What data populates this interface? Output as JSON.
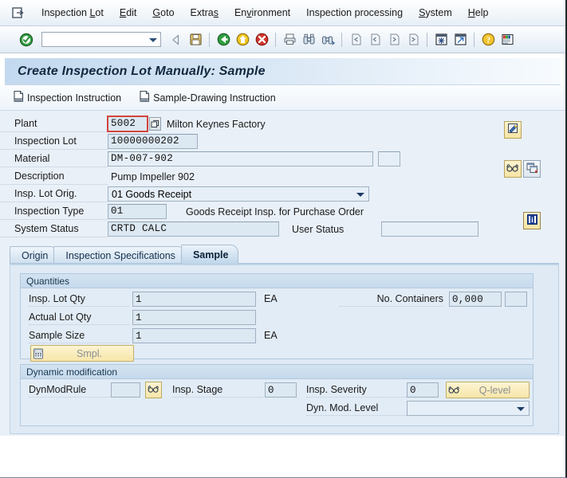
{
  "menu": {
    "system_icon": "session-icon",
    "items": [
      {
        "label": "Inspection Lot",
        "accel_index": 12
      },
      {
        "label": "Edit"
      },
      {
        "label": "Goto"
      },
      {
        "label": "Extras"
      },
      {
        "label": "Environment"
      },
      {
        "label": "Inspection processing"
      },
      {
        "label": "System"
      },
      {
        "label": "Help"
      }
    ]
  },
  "toolbar": {
    "enter_icon": "enter-check-icon",
    "command_value": "",
    "command_placeholder": "",
    "dropdown_icon": "chevron-down-icon",
    "back_icon": "back-arrow-icon",
    "save_icon": "save-disk-icon",
    "exit_back_icon": "green-back-icon",
    "exit_icon": "yellow-exit-icon",
    "cancel_icon": "red-cancel-icon",
    "print_icon": "print-icon",
    "find_icon": "find-binoculars-icon",
    "find_next_icon": "find-next-binoculars-icon",
    "first_page_icon": "first-page-icon",
    "prev_page_icon": "previous-page-icon",
    "next_page_icon": "next-page-icon",
    "last_page_icon": "last-page-icon",
    "new_session_icon": "new-session-icon",
    "shortcut_icon": "create-shortcut-icon",
    "help_icon": "help-question-icon",
    "layout_icon": "customize-layout-icon"
  },
  "title": "Create Inspection Lot Manually: Sample",
  "app_toolbar": {
    "buttons": [
      {
        "label": "Inspection Instruction",
        "icon": "document-icon"
      },
      {
        "label": "Sample-Drawing Instruction",
        "icon": "document-icon"
      }
    ]
  },
  "header_form": {
    "plant": {
      "label": "Plant",
      "value": "5002",
      "focused": true,
      "matchcode_icon": "matchcode-icon",
      "description": "Milton Keynes Factory"
    },
    "inspection_lot": {
      "label": "Inspection Lot",
      "value": "10000000202"
    },
    "material": {
      "label": "Material",
      "value": "DM-007-902"
    },
    "description": {
      "label": "Description",
      "value": "Pump Impeller 902"
    },
    "insp_lot_orig": {
      "label": "Insp. Lot Orig.",
      "value": "01 Goods Receipt",
      "dropdown_icon": "chevron-down-icon"
    },
    "inspection_type": {
      "label": "Inspection Type",
      "value": "01",
      "description": "Goods Receipt Insp. for Purchase Order"
    },
    "system_status": {
      "label": "System Status",
      "value": "CRTD CALC"
    },
    "user_status": {
      "label": "User Status",
      "value": ""
    },
    "side_buttons": [
      {
        "name": "long-text-button",
        "icon": "pencil-note-icon"
      },
      {
        "name": "classification-button",
        "icon": "glasses-icon"
      },
      {
        "name": "copy-button",
        "icon": "copy-windows-icon"
      },
      {
        "name": "status-info-button",
        "icon": "info-i-icon"
      }
    ]
  },
  "tabs": [
    {
      "label": "Origin",
      "active": false
    },
    {
      "label": "Inspection Specifications",
      "active": false
    },
    {
      "label": "Sample",
      "active": true
    }
  ],
  "quantities": {
    "title": "Quantities",
    "insp_lot_qty": {
      "label": "Insp. Lot Qty",
      "value": "1",
      "uom": "EA"
    },
    "actual_lot_qty": {
      "label": "Actual Lot Qty",
      "value": "1"
    },
    "sample_size": {
      "label": "Sample Size",
      "value": "1",
      "uom": "EA"
    },
    "no_containers": {
      "label": "No. Containers",
      "value": "0,000",
      "extra_value": ""
    },
    "smpl_button": {
      "label": "Smpl.",
      "icon": "calculator-icon"
    }
  },
  "dynamic_modification": {
    "title": "Dynamic modification",
    "dyn_mod_rule": {
      "label": "DynModRule",
      "value": ""
    },
    "dyn_mod_rule_button": {
      "icon": "glasses-icon"
    },
    "insp_stage": {
      "label": "Insp. Stage",
      "value": "0"
    },
    "insp_severity": {
      "label": "Insp. Severity",
      "value": "0"
    },
    "q_level_button": {
      "label": "Q-level",
      "icon": "glasses-icon"
    },
    "dyn_mod_level": {
      "label": "Dyn. Mod. Level",
      "value": "",
      "dropdown_icon": "chevron-down-icon"
    }
  },
  "colors": {
    "accent_blue": "#c3d9ef",
    "panel_bg": "#e9f0f8",
    "field_bg": "#dce8f2",
    "focus_red": "#d2453c",
    "button_yellow": "#f7e6a9"
  }
}
